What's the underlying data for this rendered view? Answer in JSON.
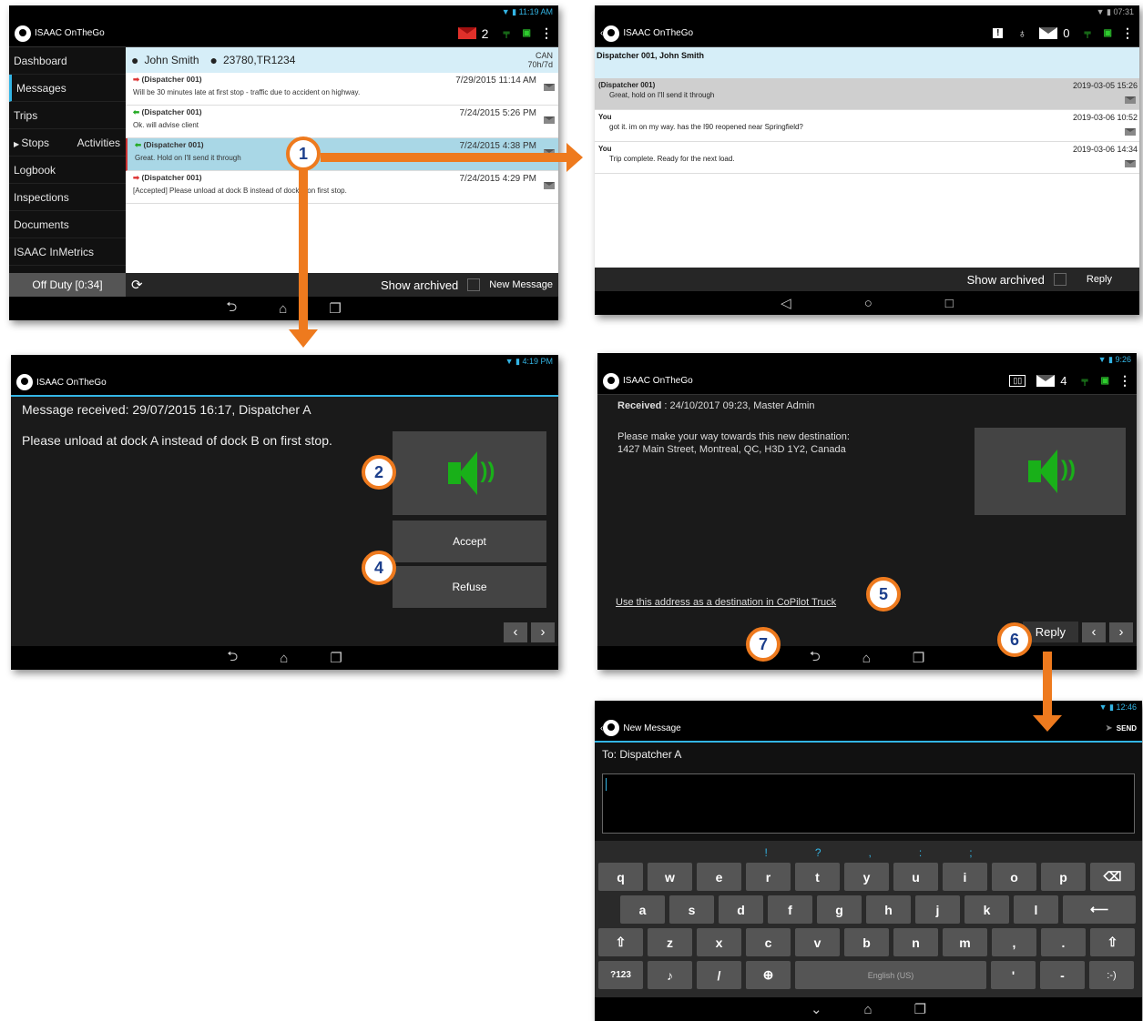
{
  "panel1": {
    "status_time": "11:19 AM",
    "app_title": "ISAAC OnTheGo",
    "unread_count": "2",
    "sidebar": [
      "Dashboard",
      "Messages",
      "Trips",
      "Stops",
      "Activities",
      "Logbook",
      "Inspections",
      "Documents",
      "ISAAC InMetrics"
    ],
    "off_duty": "Off Duty [0:34]",
    "header_name": "John Smith",
    "header_trip": "23780,TR1234",
    "header_right_1": "CAN",
    "header_right_2": "70h/7d",
    "messages": [
      {
        "from": "(Dispatcher 001)",
        "date": "7/29/2015 11:14 AM",
        "body": "Will be 30 minutes late at first stop - traffic due to accident on highway."
      },
      {
        "from": "(Dispatcher 001)",
        "date": "7/24/2015 5:26 PM",
        "body": "Ok. will advise client"
      },
      {
        "from": "(Dispatcher 001)",
        "date": "7/24/2015 4:38 PM",
        "body": "Great. Hold on I'll send it through"
      },
      {
        "from": "(Dispatcher 001)",
        "date": "7/24/2015 4:29 PM",
        "body": "[Accepted] Please unload at dock B instead of dock A on first stop."
      }
    ],
    "show_archived": "Show archived",
    "new_message": "New Message"
  },
  "panel2": {
    "status_time": "07:31",
    "app_title": "ISAAC OnTheGo",
    "msg_count": "0",
    "header": "Dispatcher 001, John Smith",
    "conversation": [
      {
        "who": "(Dispatcher 001)",
        "text": "Great, hold on I'll send it through",
        "date": "2019-03-05 15:26"
      },
      {
        "who": "You",
        "text": "got it. im on my way. has the I90 reopened near Springfield?",
        "date": "2019-03-06 10:52"
      },
      {
        "who": "You",
        "text": "Trip complete. Ready for the next load.",
        "date": "2019-03-06 14:34"
      }
    ],
    "show_archived": "Show archived",
    "reply": "Reply"
  },
  "panel3": {
    "status_time": "4:19 PM",
    "app_title": "ISAAC OnTheGo",
    "received": "Message received: 29/07/2015 16:17, Dispatcher A",
    "body": "Please unload at dock A instead of dock B on first stop.",
    "accept": "Accept",
    "refuse": "Refuse"
  },
  "panel4": {
    "status_time": "9:26",
    "app_title": "ISAAC OnTheGo",
    "msg_count": "4",
    "received_label": "Received",
    "received_value": ": 24/10/2017 09:23, Master Admin",
    "body_1": "Please make your way towards this new destination:",
    "body_2": "1427 Main Street, Montreal, QC, H3D 1Y2, Canada",
    "link": "Use this address as a destination in CoPilot Truck",
    "reply": "Reply"
  },
  "panel5": {
    "status_time": "12:46",
    "title": "New Message",
    "send": "SEND",
    "to": "To:  Dispatcher A",
    "suggestions": [
      "!",
      "?",
      ",",
      ":",
      ";"
    ],
    "row1": [
      "q",
      "w",
      "e",
      "r",
      "t",
      "y",
      "u",
      "i",
      "o",
      "p"
    ],
    "row2": [
      "a",
      "s",
      "d",
      "f",
      "g",
      "h",
      "j",
      "k",
      "l"
    ],
    "row3": [
      "z",
      "x",
      "c",
      "v",
      "b",
      "n",
      "m",
      ",",
      "."
    ],
    "num_key": "?123",
    "slash_key": "/",
    "space_label": "English (US)",
    "apos_key": "'",
    "dash_key": "-",
    "smiley_key": ":-)"
  },
  "badges": [
    "1",
    "2",
    "4",
    "5",
    "6",
    "7"
  ],
  "colors": {
    "accent": "#ee7a1e",
    "badge_text": "#1c3f8c",
    "highlight": "#33b5e5"
  }
}
